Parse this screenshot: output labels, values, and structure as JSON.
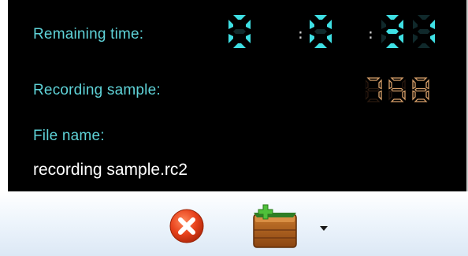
{
  "status": {
    "remaining_time_label": "Remaining time:",
    "remaining_time": {
      "hours": "0",
      "minutes": "0",
      "seconds": "31"
    },
    "recording_sample_label": "Recording sample:",
    "recording_sample_value": "758",
    "file_name_label": "File name:",
    "file_name_value": "recording sample.rc2"
  },
  "toolbar": {
    "cancel_icon": "close-circle-icon",
    "archive_icon": "add-archive-box-icon",
    "dropdown_icon": "dropdown-arrow-icon"
  },
  "colors": {
    "label": "#5fd3d8",
    "digit_time": "#3fe0e4",
    "digit_sample": "#d8a06a",
    "background": "#000000"
  }
}
